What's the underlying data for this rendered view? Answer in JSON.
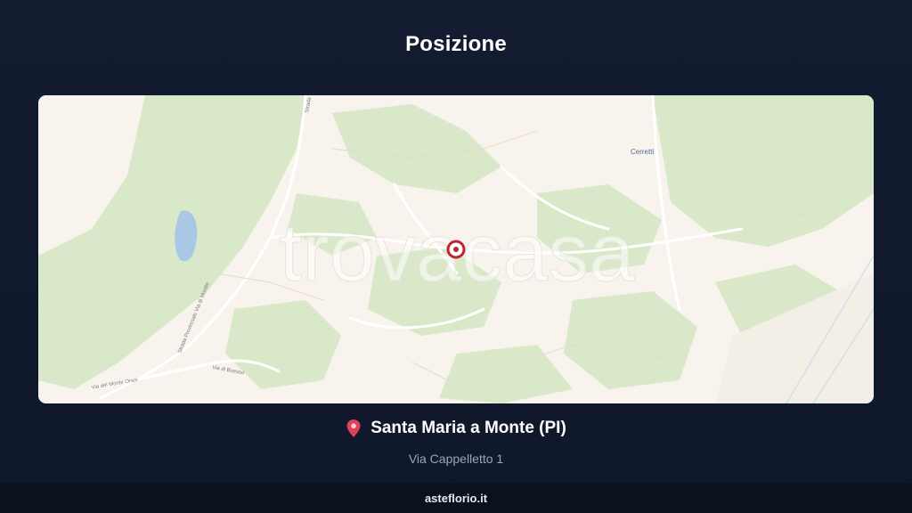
{
  "header": {
    "title": "Posizione"
  },
  "map": {
    "watermark": "trovacasa",
    "labels": {
      "cerretti": "Cerretti",
      "strada_top": "Strada",
      "strada_provinciale": "Strada Provinciale Via di Montte",
      "via_monte_orsoi": "Via del Monte Orsoi",
      "via_buesso": "Via di Buesso"
    },
    "colors": {
      "land": "#f8f3ec",
      "forest": "#d6e6c6",
      "water": "#a9c8e6",
      "marker": "#c0242e"
    }
  },
  "location": {
    "pin_icon": "red-pin",
    "name": "Santa Maria a Monte (PI)",
    "address": "Via Cappelletto 1"
  },
  "footer": {
    "site": "asteflorio.it"
  }
}
